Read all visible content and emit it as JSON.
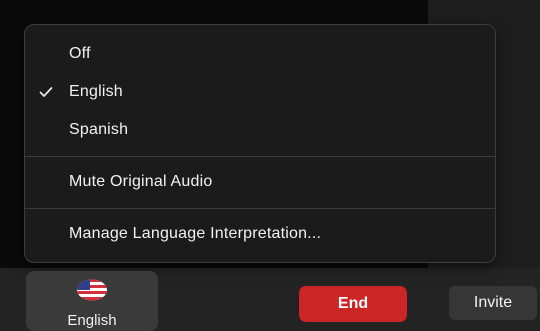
{
  "menu": {
    "items": [
      {
        "label": "Off",
        "checked": false
      },
      {
        "label": "English",
        "checked": true
      },
      {
        "label": "Spanish",
        "checked": false
      }
    ],
    "mute_label": "Mute Original Audio",
    "manage_label": "Manage Language Interpretation..."
  },
  "toolbar": {
    "language": {
      "label": "English",
      "icon": "us-flag-icon"
    },
    "end_label": "End",
    "invite_label": "Invite"
  },
  "colors": {
    "end_button": "#cc2525",
    "menu_background": "#1b1b1b",
    "toolbar_background": "#232323"
  }
}
